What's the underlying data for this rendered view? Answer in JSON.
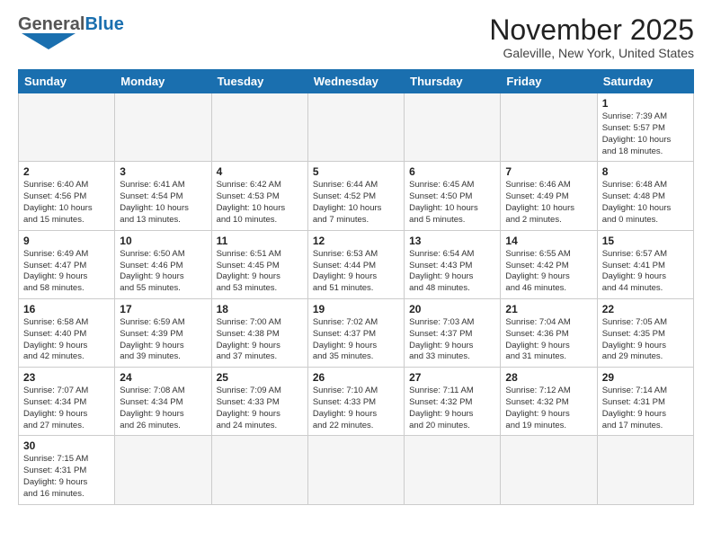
{
  "header": {
    "logo_general": "General",
    "logo_blue": "Blue",
    "month_title": "November 2025",
    "location": "Galeville, New York, United States"
  },
  "weekdays": [
    "Sunday",
    "Monday",
    "Tuesday",
    "Wednesday",
    "Thursday",
    "Friday",
    "Saturday"
  ],
  "weeks": [
    [
      {
        "day": "",
        "info": ""
      },
      {
        "day": "",
        "info": ""
      },
      {
        "day": "",
        "info": ""
      },
      {
        "day": "",
        "info": ""
      },
      {
        "day": "",
        "info": ""
      },
      {
        "day": "",
        "info": ""
      },
      {
        "day": "1",
        "info": "Sunrise: 7:39 AM\nSunset: 5:57 PM\nDaylight: 10 hours\nand 18 minutes."
      }
    ],
    [
      {
        "day": "2",
        "info": "Sunrise: 6:40 AM\nSunset: 4:56 PM\nDaylight: 10 hours\nand 15 minutes."
      },
      {
        "day": "3",
        "info": "Sunrise: 6:41 AM\nSunset: 4:54 PM\nDaylight: 10 hours\nand 13 minutes."
      },
      {
        "day": "4",
        "info": "Sunrise: 6:42 AM\nSunset: 4:53 PM\nDaylight: 10 hours\nand 10 minutes."
      },
      {
        "day": "5",
        "info": "Sunrise: 6:44 AM\nSunset: 4:52 PM\nDaylight: 10 hours\nand 7 minutes."
      },
      {
        "day": "6",
        "info": "Sunrise: 6:45 AM\nSunset: 4:50 PM\nDaylight: 10 hours\nand 5 minutes."
      },
      {
        "day": "7",
        "info": "Sunrise: 6:46 AM\nSunset: 4:49 PM\nDaylight: 10 hours\nand 2 minutes."
      },
      {
        "day": "8",
        "info": "Sunrise: 6:48 AM\nSunset: 4:48 PM\nDaylight: 10 hours\nand 0 minutes."
      }
    ],
    [
      {
        "day": "9",
        "info": "Sunrise: 6:49 AM\nSunset: 4:47 PM\nDaylight: 9 hours\nand 58 minutes."
      },
      {
        "day": "10",
        "info": "Sunrise: 6:50 AM\nSunset: 4:46 PM\nDaylight: 9 hours\nand 55 minutes."
      },
      {
        "day": "11",
        "info": "Sunrise: 6:51 AM\nSunset: 4:45 PM\nDaylight: 9 hours\nand 53 minutes."
      },
      {
        "day": "12",
        "info": "Sunrise: 6:53 AM\nSunset: 4:44 PM\nDaylight: 9 hours\nand 51 minutes."
      },
      {
        "day": "13",
        "info": "Sunrise: 6:54 AM\nSunset: 4:43 PM\nDaylight: 9 hours\nand 48 minutes."
      },
      {
        "day": "14",
        "info": "Sunrise: 6:55 AM\nSunset: 4:42 PM\nDaylight: 9 hours\nand 46 minutes."
      },
      {
        "day": "15",
        "info": "Sunrise: 6:57 AM\nSunset: 4:41 PM\nDaylight: 9 hours\nand 44 minutes."
      }
    ],
    [
      {
        "day": "16",
        "info": "Sunrise: 6:58 AM\nSunset: 4:40 PM\nDaylight: 9 hours\nand 42 minutes."
      },
      {
        "day": "17",
        "info": "Sunrise: 6:59 AM\nSunset: 4:39 PM\nDaylight: 9 hours\nand 39 minutes."
      },
      {
        "day": "18",
        "info": "Sunrise: 7:00 AM\nSunset: 4:38 PM\nDaylight: 9 hours\nand 37 minutes."
      },
      {
        "day": "19",
        "info": "Sunrise: 7:02 AM\nSunset: 4:37 PM\nDaylight: 9 hours\nand 35 minutes."
      },
      {
        "day": "20",
        "info": "Sunrise: 7:03 AM\nSunset: 4:37 PM\nDaylight: 9 hours\nand 33 minutes."
      },
      {
        "day": "21",
        "info": "Sunrise: 7:04 AM\nSunset: 4:36 PM\nDaylight: 9 hours\nand 31 minutes."
      },
      {
        "day": "22",
        "info": "Sunrise: 7:05 AM\nSunset: 4:35 PM\nDaylight: 9 hours\nand 29 minutes."
      }
    ],
    [
      {
        "day": "23",
        "info": "Sunrise: 7:07 AM\nSunset: 4:34 PM\nDaylight: 9 hours\nand 27 minutes."
      },
      {
        "day": "24",
        "info": "Sunrise: 7:08 AM\nSunset: 4:34 PM\nDaylight: 9 hours\nand 26 minutes."
      },
      {
        "day": "25",
        "info": "Sunrise: 7:09 AM\nSunset: 4:33 PM\nDaylight: 9 hours\nand 24 minutes."
      },
      {
        "day": "26",
        "info": "Sunrise: 7:10 AM\nSunset: 4:33 PM\nDaylight: 9 hours\nand 22 minutes."
      },
      {
        "day": "27",
        "info": "Sunrise: 7:11 AM\nSunset: 4:32 PM\nDaylight: 9 hours\nand 20 minutes."
      },
      {
        "day": "28",
        "info": "Sunrise: 7:12 AM\nSunset: 4:32 PM\nDaylight: 9 hours\nand 19 minutes."
      },
      {
        "day": "29",
        "info": "Sunrise: 7:14 AM\nSunset: 4:31 PM\nDaylight: 9 hours\nand 17 minutes."
      }
    ],
    [
      {
        "day": "30",
        "info": "Sunrise: 7:15 AM\nSunset: 4:31 PM\nDaylight: 9 hours\nand 16 minutes."
      },
      {
        "day": "",
        "info": ""
      },
      {
        "day": "",
        "info": ""
      },
      {
        "day": "",
        "info": ""
      },
      {
        "day": "",
        "info": ""
      },
      {
        "day": "",
        "info": ""
      },
      {
        "day": "",
        "info": ""
      }
    ]
  ]
}
